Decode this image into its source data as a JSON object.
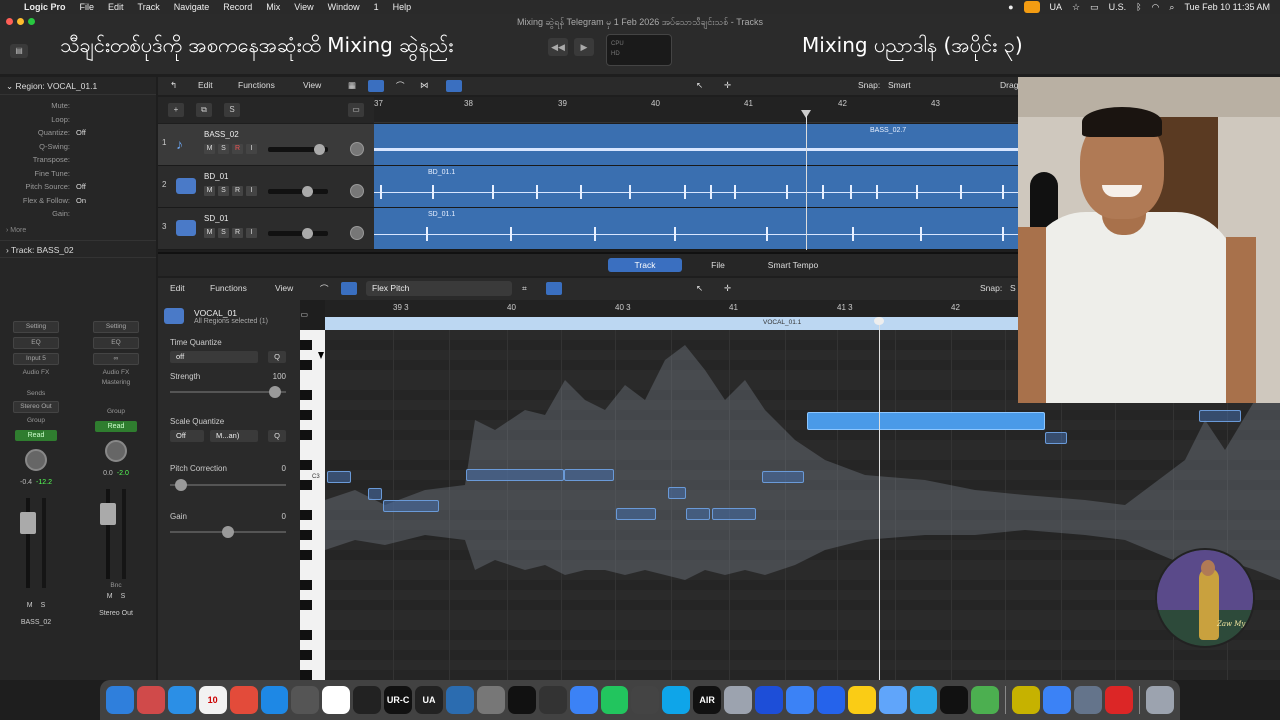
{
  "menubar": {
    "app": "Logic Pro",
    "items": [
      "File",
      "Edit",
      "Track",
      "Navigate",
      "Record",
      "Mix",
      "View",
      "Window",
      "1",
      "Help"
    ],
    "clock": "Tue Feb 10  11:35 AM",
    "keyboard": "U.S.",
    "ua": "UA"
  },
  "window": {
    "title": "Mixing ဆွဲရန် Telegram မှ 1 Feb 2026 အပ်သောသီချင်းသစ် - Tracks",
    "overlay_left": "သီချင်းတစ်ပုဒ်ကို အစကနေအဆုံးထိ Mixing ဆွဲနည်း",
    "overlay_right": "Mixing ပညာဒါန (အပိုင်း ၃)",
    "lcd_line1": "CPU",
    "lcd_line2": "HD"
  },
  "inspector": {
    "region_header": "Region: VOCAL_01.1",
    "rows": [
      {
        "k": "Mute:",
        "v": ""
      },
      {
        "k": "Loop:",
        "v": ""
      },
      {
        "k": "Quantize:",
        "v": "Off"
      },
      {
        "k": "Q-Swing:",
        "v": ""
      },
      {
        "k": "Transpose:",
        "v": ""
      },
      {
        "k": "Fine Tune:",
        "v": ""
      },
      {
        "k": "Pitch Source:",
        "v": "Off"
      },
      {
        "k": "Flex & Follow:",
        "v": "On"
      },
      {
        "k": "Gain:",
        "v": ""
      }
    ],
    "more": "More",
    "track_header": "Track:  BASS_02",
    "strip1": {
      "setting": "Setting",
      "eq": "EQ",
      "input": "Input 5",
      "audiofx": "Audio FX",
      "sends": "Sends",
      "output": "Stereo Out",
      "group": "Group",
      "auto": "Read",
      "val1": "-0.4",
      "val2": "-12.2",
      "m": "M",
      "s": "S",
      "name": "BASS_02"
    },
    "strip2": {
      "setting": "Setting",
      "eq": "EQ",
      "audiofx": "Audio FX",
      "mastering": "Mastering",
      "group": "Group",
      "auto": "Read",
      "val1": "0.0",
      "val2": "-2.0",
      "bnc": "Bnc",
      "m": "M",
      "s": "S",
      "name": "Stereo Out"
    }
  },
  "tracks_toolbar": {
    "edit": "Edit",
    "functions": "Functions",
    "view": "View",
    "snap_label": "Snap:",
    "snap_value": "Smart",
    "drag": "Drag"
  },
  "tracks_header_buttons": {
    "add": "+",
    "dup": "⧉",
    "s": "S"
  },
  "ruler": [
    "37",
    "38",
    "39",
    "40",
    "41",
    "42",
    "43"
  ],
  "tracks": [
    {
      "num": "1",
      "name": "BASS_02",
      "region": "BASS_02.7",
      "m": "M",
      "s": "S",
      "r": "R",
      "i": "I"
    },
    {
      "num": "2",
      "name": "BD_01",
      "region": "BD_01.1",
      "m": "M",
      "s": "S",
      "r": "R",
      "i": "I"
    },
    {
      "num": "3",
      "name": "SD_01",
      "region": "SD_01.1",
      "m": "M",
      "s": "S",
      "r": "R",
      "i": "I"
    }
  ],
  "editor": {
    "tabs": [
      "Track",
      "File",
      "Smart Tempo"
    ],
    "edit": "Edit",
    "functions": "Functions",
    "view": "View",
    "mode": "Flex Pitch",
    "snap_label": "Snap:",
    "snap_value": "S",
    "region_name": "VOCAL_01",
    "region_sub": "All Regions selected (1)",
    "time_quantize_label": "Time Quantize",
    "time_quantize_value": "off",
    "strength_label": "Strength",
    "strength_value": "100",
    "strength_fraction": 0.95,
    "scale_quantize_label": "Scale Quantize",
    "scale_off": "Off",
    "scale_mode": "M...an)",
    "q": "Q",
    "pitch_correction_label": "Pitch Correction",
    "pitch_correction_value": "0",
    "pitch_correction_fraction": 0.05,
    "gain_label": "Gain",
    "gain_value": "0",
    "gain_fraction": 0.5,
    "ruler": [
      "39 3",
      "40",
      "40 3",
      "41",
      "41 3",
      "42"
    ],
    "region_label": "VOCAL_01.1",
    "c3": "C3"
  },
  "logo_signature": "Zaw Myo",
  "dock_items": [
    {
      "name": "finder",
      "color": "#2f7fdc",
      "label": ""
    },
    {
      "name": "launchpad",
      "color": "#d04a4a",
      "label": ""
    },
    {
      "name": "safari",
      "color": "#2b8fe6",
      "label": ""
    },
    {
      "name": "calendar",
      "color": "#f2f2f2",
      "label": "10"
    },
    {
      "name": "chrome",
      "color": "#e34b3a",
      "label": ""
    },
    {
      "name": "app-store",
      "color": "#1e88e5",
      "label": ""
    },
    {
      "name": "calculator",
      "color": "#555555",
      "label": ""
    },
    {
      "name": "photos",
      "color": "#ffffff",
      "label": ""
    },
    {
      "name": "activity-monitor",
      "color": "#222222",
      "label": ""
    },
    {
      "name": "ur-c",
      "color": "#111111",
      "label": "UR-C"
    },
    {
      "name": "ua",
      "color": "#222222",
      "label": "UA"
    },
    {
      "name": "zoom-app",
      "color": "#2b6cb0",
      "label": ""
    },
    {
      "name": "settings",
      "color": "#777777",
      "label": ""
    },
    {
      "name": "logic",
      "color": "#111111",
      "label": ""
    },
    {
      "name": "network",
      "color": "#333333",
      "label": ""
    },
    {
      "name": "messenger",
      "color": "#3b82f6",
      "label": ""
    },
    {
      "name": "cloud",
      "color": "#22c55e",
      "label": ""
    },
    {
      "name": "final-cut",
      "color": "#444444",
      "label": ""
    },
    {
      "name": "x-app",
      "color": "#0ea5e9",
      "label": ""
    },
    {
      "name": "air",
      "color": "#111111",
      "label": "AIR"
    },
    {
      "name": "disk",
      "color": "#9ca3af",
      "label": ""
    },
    {
      "name": "shield",
      "color": "#1d4ed8",
      "label": ""
    },
    {
      "name": "safari-2",
      "color": "#3b82f6",
      "label": ""
    },
    {
      "name": "zoom",
      "color": "#2563eb",
      "label": ""
    },
    {
      "name": "notes",
      "color": "#facc15",
      "label": ""
    },
    {
      "name": "freeform",
      "color": "#60a5fa",
      "label": ""
    },
    {
      "name": "telegram",
      "color": "#27a7e7",
      "label": ""
    },
    {
      "name": "midi",
      "color": "#111111",
      "label": ""
    },
    {
      "name": "utorrent",
      "color": "#4caf50",
      "label": ""
    },
    {
      "name": "winamp",
      "color": "#c6b200",
      "label": ""
    },
    {
      "name": "messenger-2",
      "color": "#3b82f6",
      "label": ""
    },
    {
      "name": "preview",
      "color": "#64748b",
      "label": ""
    },
    {
      "name": "pdf",
      "color": "#dc2626",
      "label": ""
    },
    {
      "name": "trash",
      "color": "#9ca3af",
      "label": ""
    }
  ],
  "colors": {
    "region_blue": "#3a6fb0",
    "accent": "#3a6fc0",
    "note_selected": "#4a9ae8"
  }
}
